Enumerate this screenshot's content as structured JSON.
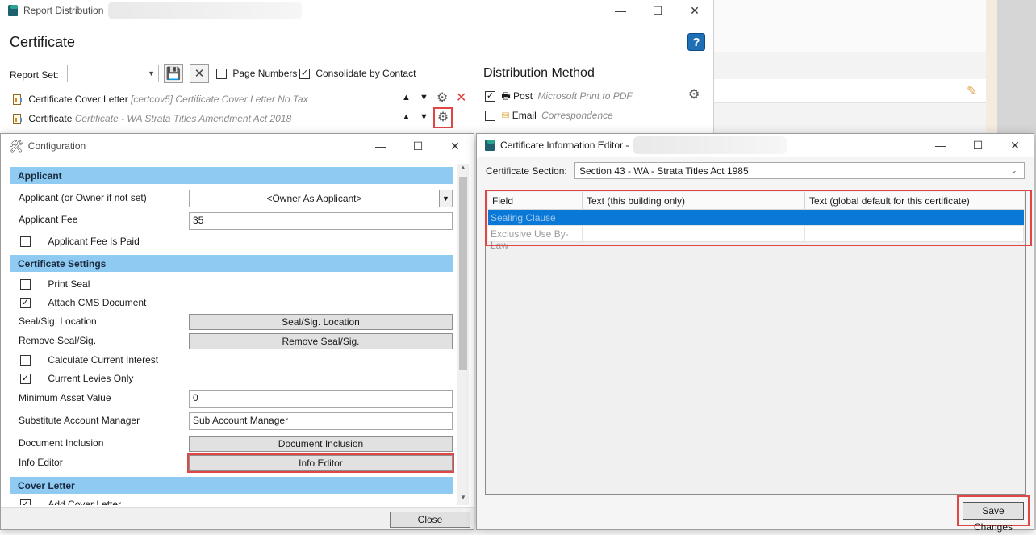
{
  "report_distribution": {
    "title": "Report Distribution",
    "heading": "Certificate",
    "help_icon": "?",
    "report_set_label": "Report Set:",
    "report_set_value": "",
    "page_numbers_label": "Page Numbers",
    "page_numbers_checked": false,
    "consolidate_label": "Consolidate by Contact",
    "consolidate_checked": true,
    "reports": [
      {
        "name": "Certificate Cover Letter",
        "detail": "[certcov5] Certificate Cover Letter No Tax"
      },
      {
        "name": "Certificate",
        "detail": "Certificate - WA Strata Titles Amendment Act 2018"
      }
    ],
    "distribution_method_heading": "Distribution Method",
    "methods": [
      {
        "name": "Post",
        "detail": "Microsoft Print to PDF",
        "checked": true
      },
      {
        "name": "Email",
        "detail": "Correspondence",
        "checked": false
      }
    ]
  },
  "configuration": {
    "title": "Configuration",
    "sections": {
      "applicant": "Applicant",
      "certificate_settings": "Certificate Settings",
      "cover_letter": "Cover Letter"
    },
    "applicant_label": "Applicant (or Owner if not set)",
    "applicant_value": "<Owner As Applicant>",
    "applicant_fee_label": "Applicant Fee",
    "applicant_fee_value": "35",
    "applicant_fee_paid_label": "Applicant Fee Is Paid",
    "print_seal_label": "Print Seal",
    "attach_cms_label": "Attach CMS Document",
    "seal_location_label": "Seal/Sig. Location",
    "seal_location_button": "Seal/Sig. Location",
    "remove_seal_label": "Remove Seal/Sig.",
    "remove_seal_button": "Remove Seal/Sig.",
    "calc_interest_label": "Calculate Current Interest",
    "current_levies_label": "Current Levies Only",
    "min_asset_label": "Minimum Asset Value",
    "min_asset_value": "0",
    "sub_account_label": "Substitute Account Manager",
    "sub_account_value": "Sub Account Manager",
    "doc_inclusion_label": "Document Inclusion",
    "doc_inclusion_button": "Document Inclusion",
    "info_editor_label": "Info Editor",
    "info_editor_button": "Info Editor",
    "add_cover_letter_label": "Add Cover Letter",
    "close_button": "Close"
  },
  "cert_info_editor": {
    "title": "Certificate Information Editor -",
    "section_label": "Certificate Section:",
    "section_value": "Section 43 - WA - Strata Titles Act 1985",
    "columns": [
      "Field",
      "Text (this building only)",
      "Text (global default for this certificate)"
    ],
    "rows": [
      {
        "field": "Sealing Clause",
        "building": "",
        "global": ""
      },
      {
        "field": "Exclusive Use By-Law",
        "building": "",
        "global": ""
      }
    ],
    "save_button": "Save Changes"
  }
}
